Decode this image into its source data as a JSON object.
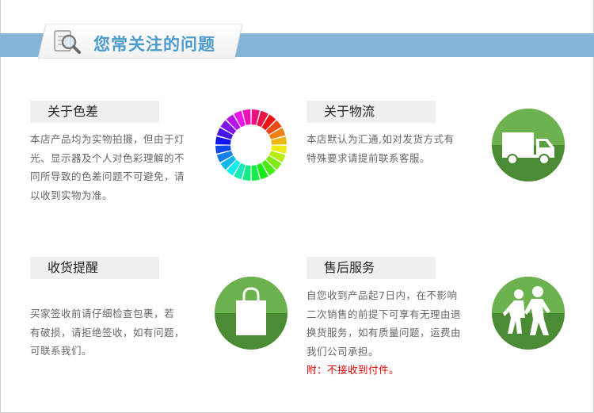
{
  "header": {
    "title": "您常关注的问题",
    "icon": "magnifier-document-icon",
    "band_color": "#85b5d6",
    "title_color": "#4b9bcd"
  },
  "sections": {
    "color": {
      "title": "关于色差",
      "lines": [
        "本店产品均为实物拍摄，但由于灯",
        "光、显示器及个人对色彩理解的不",
        "同所导致的色差问题不可避免，请",
        "以收到实物为准。"
      ],
      "icon": "color-wheel-icon"
    },
    "logistics": {
      "title": "关于物流",
      "lines": [
        "本店默认为汇通,如对发货方式有",
        "特殊要求请提前联系客服。"
      ],
      "icon": "truck-icon"
    },
    "receipt": {
      "title": "收货提醒",
      "lines": [
        "买家签收前请仔细检查包裹，若",
        "有破损，请拒绝签收，如有问题，",
        "可联系我们。"
      ],
      "icon": "shopping-bag-icon"
    },
    "aftersale": {
      "title": "售后服务",
      "lines": [
        "自您收到产品起7日内，在不影响",
        "二次销售的前提下可享有无理由退",
        "换货服务，如有质量问题，运费由",
        "我们公司承担。"
      ],
      "note": "附：不接收到付件。",
      "icon": "people-walking-icon"
    }
  },
  "colors": {
    "green_light": "#6cb24f",
    "green_dark": "#4a8b33",
    "title_bg": "#efefef",
    "note_red": "#e00000"
  }
}
